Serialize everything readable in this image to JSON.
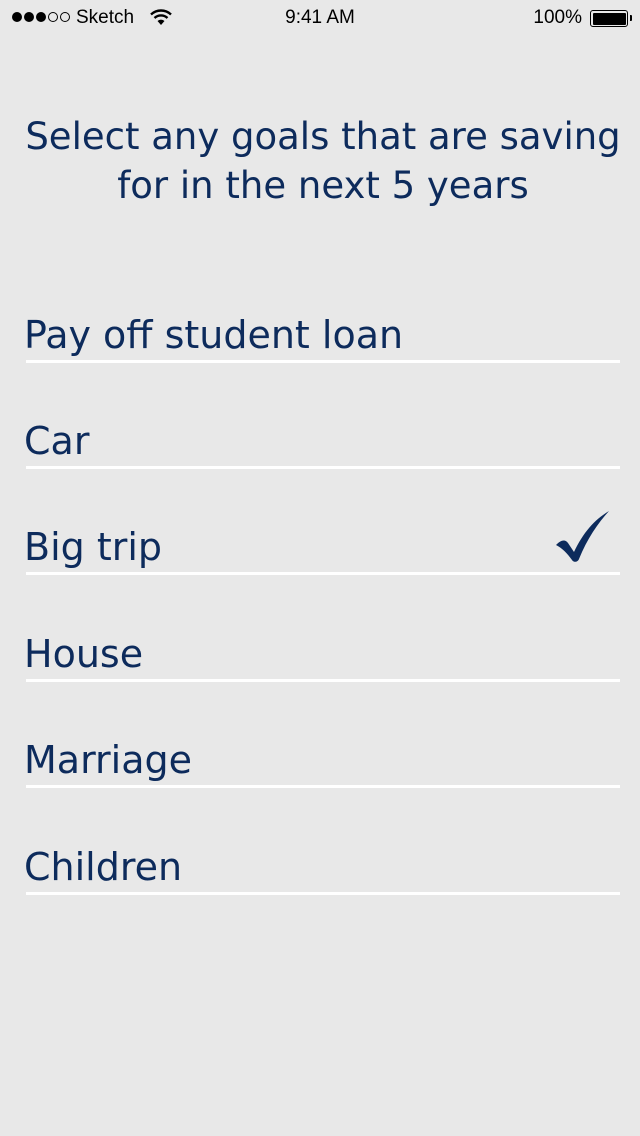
{
  "status_bar": {
    "carrier": "Sketch",
    "time": "9:41 AM",
    "battery_percent": "100%",
    "signal_bars_filled": 3,
    "signal_bars_total": 5,
    "icons": [
      "signal-icon",
      "wifi-icon",
      "battery-icon"
    ]
  },
  "page": {
    "title": "Select any goals that are saving for in the next 5 years"
  },
  "goals": [
    {
      "label": "Pay off student loan",
      "selected": false
    },
    {
      "label": "Car",
      "selected": false
    },
    {
      "label": "Big trip",
      "selected": true
    },
    {
      "label": "House",
      "selected": false
    },
    {
      "label": "Marriage",
      "selected": false
    },
    {
      "label": "Children",
      "selected": false
    }
  ],
  "colors": {
    "background": "#e8e8e8",
    "text": "#0d2b5c",
    "divider": "#ffffff",
    "checkmark": "#0d2b5c"
  }
}
